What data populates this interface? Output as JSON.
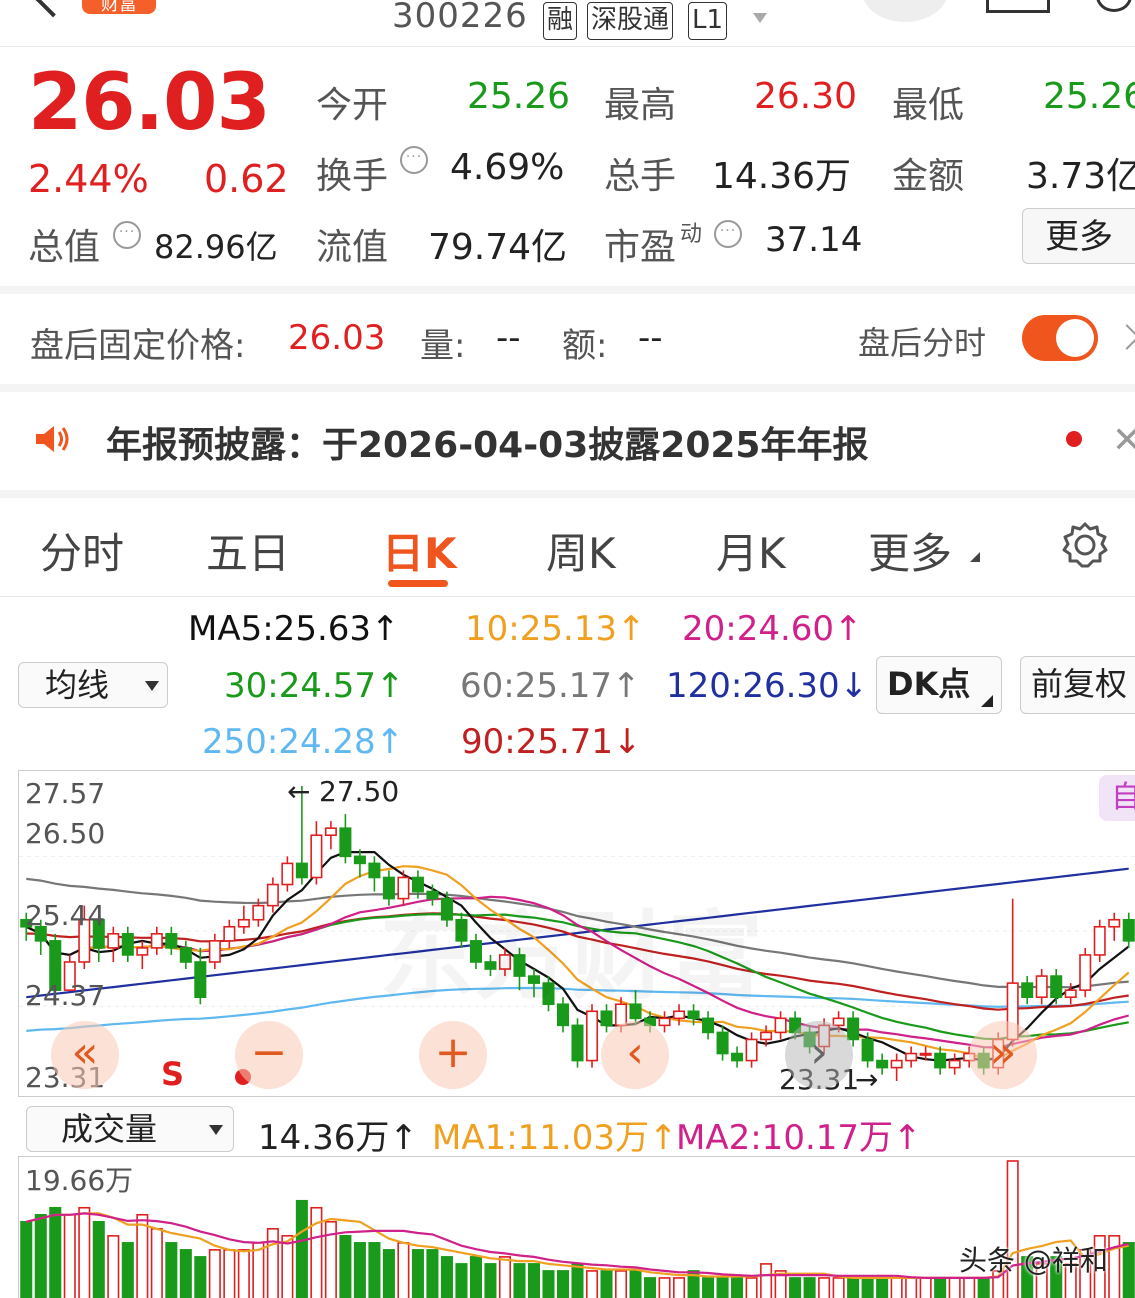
{
  "header": {
    "badge": "财富",
    "stock_code": "300226",
    "tags": [
      "融",
      "深股通",
      "L1"
    ]
  },
  "quote": {
    "price": "26.03",
    "change_pct": "2.44%",
    "change_amt": "0.62",
    "open_label": "今开",
    "open": "25.26",
    "high_label": "最高",
    "high": "26.30",
    "low_label": "最低",
    "low": "25.26",
    "turnover_label": "换手",
    "turnover": "4.69%",
    "volume_label": "总手",
    "volume": "14.36万",
    "amount_label": "金额",
    "amount": "3.73亿",
    "mktcap_label": "总值",
    "mktcap": "82.96亿",
    "float_label": "流值",
    "float": "79.74亿",
    "pe_label": "市盈",
    "pe_sup": "动",
    "pe": "37.14",
    "more": "更多"
  },
  "afterhours": {
    "label": "盘后固定价格:",
    "price": "26.03",
    "vol_label": "量:",
    "vol": "--",
    "amt_label": "额:",
    "amt": "--",
    "toggle_label": "盘后分时",
    "toggle_on": true
  },
  "notice": {
    "text": "年报预披露：于2026-04-03披露2025年年报"
  },
  "tabs": [
    "分时",
    "五日",
    "日K",
    "周K",
    "月K",
    "更多"
  ],
  "active_tab": "日K",
  "ma": {
    "ma5": "MA5:25.63↑",
    "ma10": "10:25.13↑",
    "ma20": "20:24.60↑",
    "ma30": "30:24.57↑",
    "ma60": "60:25.17↑",
    "ma120": "120:26.30↓",
    "ma250": "250:24.28↑",
    "ma90": "90:25.71↓",
    "selector": "均线",
    "dk": "DK点",
    "adjust": "前复权",
    "colors": {
      "ma5": "#111111",
      "ma10": "#f0a020",
      "ma20": "#d0208a",
      "ma30": "#1a9a1a",
      "ma60": "#777777",
      "ma120": "#2030a0",
      "ma250": "#60b8f0",
      "ma90": "#c02020"
    }
  },
  "kchart": {
    "ylabels": [
      "27.57",
      "26.50",
      "25.44",
      "24.37",
      "23.31"
    ],
    "high_marker": "27.50",
    "low_marker": "23.31",
    "side_tab": "自",
    "s_marker": "S",
    "watermark": "东方财富",
    "buttons": [
      "«",
      "−",
      "+",
      "‹",
      "›"
    ]
  },
  "volume": {
    "selector": "成交量",
    "current": "14.36万↑",
    "ma1": "MA1:11.03万↑",
    "ma2": "MA2:10.17万↑",
    "max_label": "19.66万",
    "watermark": "头条 @祥和"
  },
  "chart_data": {
    "type": "candlestick",
    "ylim": [
      23.31,
      27.57
    ],
    "candles": [
      [
        25.6,
        25.5,
        25.7,
        25.3
      ],
      [
        25.5,
        25.3,
        25.6,
        25.1
      ],
      [
        25.3,
        24.6,
        25.4,
        24.5
      ],
      [
        24.6,
        25.0,
        25.1,
        24.6
      ],
      [
        25.0,
        25.6,
        25.8,
        24.9
      ],
      [
        25.6,
        25.2,
        25.7,
        25.0
      ],
      [
        25.2,
        25.4,
        25.5,
        25.0
      ],
      [
        25.4,
        25.1,
        25.5,
        25.0
      ],
      [
        25.1,
        25.2,
        25.3,
        24.9
      ],
      [
        25.2,
        25.4,
        25.5,
        25.1
      ],
      [
        25.4,
        25.2,
        25.5,
        25.1
      ],
      [
        25.2,
        25.0,
        25.3,
        24.9
      ],
      [
        25.0,
        24.5,
        25.2,
        24.4
      ],
      [
        25.0,
        25.3,
        25.4,
        24.9
      ],
      [
        25.3,
        25.5,
        25.6,
        25.2
      ],
      [
        25.5,
        25.6,
        25.8,
        25.4
      ],
      [
        25.6,
        25.8,
        25.9,
        25.5
      ],
      [
        25.8,
        26.1,
        26.2,
        25.7
      ],
      [
        26.1,
        26.4,
        26.5,
        26.0
      ],
      [
        26.4,
        26.2,
        27.5,
        26.1
      ],
      [
        26.2,
        26.8,
        27.0,
        26.1
      ],
      [
        26.8,
        26.9,
        27.0,
        26.6
      ],
      [
        26.9,
        26.5,
        27.1,
        26.4
      ],
      [
        26.5,
        26.4,
        26.6,
        26.2
      ],
      [
        26.4,
        26.2,
        26.5,
        26.0
      ],
      [
        26.2,
        25.9,
        26.3,
        25.8
      ],
      [
        25.9,
        26.2,
        26.3,
        25.8
      ],
      [
        26.2,
        26.0,
        26.3,
        25.9
      ],
      [
        26.0,
        25.9,
        26.1,
        25.8
      ],
      [
        25.9,
        25.6,
        26.0,
        25.5
      ],
      [
        25.6,
        25.3,
        25.7,
        25.2
      ],
      [
        25.3,
        25.0,
        25.4,
        24.9
      ],
      [
        25.0,
        24.9,
        25.1,
        24.8
      ],
      [
        24.9,
        25.1,
        25.2,
        24.8
      ],
      [
        25.1,
        24.8,
        25.2,
        24.6
      ],
      [
        24.8,
        24.7,
        24.9,
        24.5
      ],
      [
        24.7,
        24.4,
        24.8,
        24.3
      ],
      [
        24.4,
        24.1,
        24.5,
        24.0
      ],
      [
        24.1,
        23.6,
        24.2,
        23.5
      ],
      [
        23.6,
        24.3,
        24.4,
        23.5
      ],
      [
        24.3,
        24.1,
        24.4,
        24.0
      ],
      [
        24.1,
        24.4,
        24.5,
        24.0
      ],
      [
        24.4,
        24.2,
        24.6,
        24.1
      ],
      [
        24.2,
        24.1,
        24.3,
        24.0
      ],
      [
        24.1,
        24.2,
        24.3,
        24.0
      ],
      [
        24.2,
        24.3,
        24.4,
        24.1
      ],
      [
        24.3,
        24.2,
        24.4,
        24.1
      ],
      [
        24.2,
        24.0,
        24.3,
        23.9
      ],
      [
        24.0,
        23.7,
        24.1,
        23.6
      ],
      [
        23.7,
        23.6,
        23.8,
        23.5
      ],
      [
        23.6,
        23.9,
        24.0,
        23.5
      ],
      [
        23.9,
        24.0,
        24.1,
        23.8
      ],
      [
        24.0,
        24.2,
        24.3,
        23.9
      ],
      [
        24.2,
        24.0,
        24.3,
        23.9
      ],
      [
        24.0,
        23.8,
        24.1,
        23.7
      ],
      [
        23.8,
        24.1,
        24.2,
        23.7
      ],
      [
        24.1,
        24.2,
        24.3,
        24.0
      ],
      [
        24.2,
        23.9,
        24.3,
        23.8
      ],
      [
        23.9,
        23.6,
        24.0,
        23.5
      ],
      [
        23.6,
        23.5,
        23.7,
        23.4
      ],
      [
        23.5,
        23.6,
        23.7,
        23.31
      ],
      [
        23.6,
        23.7,
        23.8,
        23.5
      ],
      [
        23.7,
        23.7,
        23.8,
        23.6
      ],
      [
        23.7,
        23.5,
        23.8,
        23.4
      ],
      [
        23.5,
        23.6,
        23.7,
        23.4
      ],
      [
        23.6,
        23.7,
        23.8,
        23.5
      ],
      [
        23.7,
        23.5,
        23.8,
        23.4
      ],
      [
        23.5,
        23.9,
        24.0,
        23.4
      ],
      [
        23.9,
        24.7,
        25.9,
        23.8
      ],
      [
        24.7,
        24.5,
        24.8,
        24.4
      ],
      [
        24.5,
        24.8,
        24.9,
        24.4
      ],
      [
        24.8,
        24.5,
        24.9,
        24.4
      ],
      [
        24.5,
        24.6,
        24.7,
        24.4
      ],
      [
        24.6,
        25.1,
        25.2,
        24.5
      ],
      [
        25.1,
        25.5,
        25.6,
        25.0
      ],
      [
        25.5,
        25.6,
        25.7,
        25.3
      ],
      [
        25.6,
        25.3,
        25.7,
        25.2
      ]
    ],
    "volumes": [
      11,
      12,
      13,
      12,
      13,
      11,
      9,
      8,
      12,
      10,
      8,
      7,
      6,
      7,
      7,
      7,
      8,
      10,
      9,
      14,
      13,
      11,
      9,
      8,
      8,
      7,
      8,
      7,
      7,
      6,
      5,
      6,
      5,
      6,
      5,
      5,
      4,
      4,
      5,
      4,
      4,
      4,
      4,
      3,
      3,
      3,
      4,
      3,
      3,
      3,
      3,
      5,
      4,
      3,
      3,
      3,
      3,
      3,
      3,
      3,
      3,
      3,
      3,
      3,
      3,
      3,
      3,
      4,
      19.66,
      6,
      5,
      6,
      5,
      7,
      9,
      9,
      8
    ]
  }
}
